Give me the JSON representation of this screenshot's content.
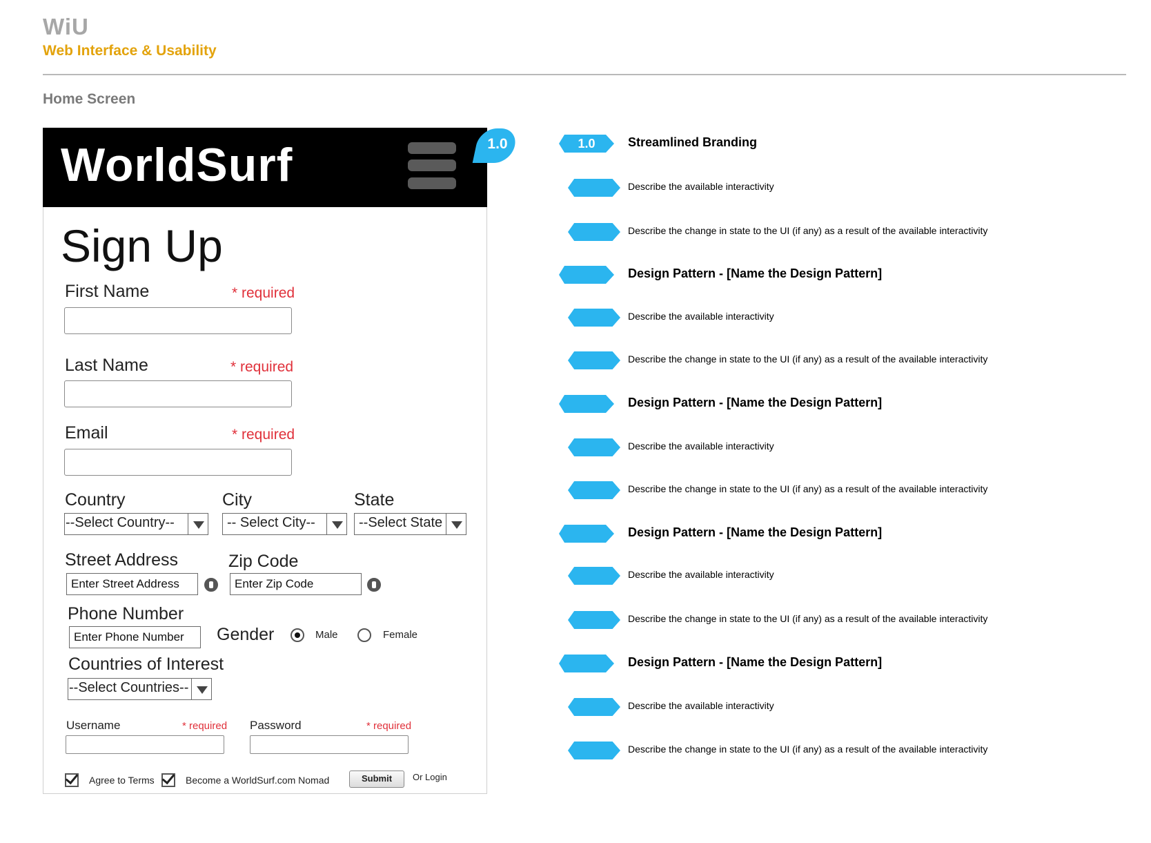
{
  "header": {
    "brand": "WiU",
    "subtitle": "Web Interface & Usability",
    "screen_title": "Home Screen"
  },
  "mockup": {
    "logo": "WorldSurf",
    "badge": "1.0",
    "page_title": "Sign Up",
    "first_name": {
      "label": "First Name",
      "required": "* required"
    },
    "last_name": {
      "label": "Last Name",
      "required": "* required"
    },
    "email": {
      "label": "Email",
      "required": "* required"
    },
    "country": {
      "label": "Country",
      "value": "--Select Country--"
    },
    "city": {
      "label": "City",
      "value": "-- Select City--"
    },
    "state": {
      "label": "State",
      "value": "--Select State"
    },
    "street": {
      "label": "Street Address",
      "placeholder": "Enter Street Address"
    },
    "zip": {
      "label": "Zip Code",
      "placeholder": "Enter Zip Code"
    },
    "phone": {
      "label": "Phone Number",
      "placeholder": "Enter Phone Number"
    },
    "gender": {
      "label": "Gender",
      "male": "Male",
      "female": "Female",
      "selected": "Male"
    },
    "countries_interest": {
      "label": "Countries of Interest",
      "value": "--Select Countries--"
    },
    "username": {
      "label": "Username",
      "required": "* required"
    },
    "password": {
      "label": "Password",
      "required": "* required"
    },
    "agree_terms": "Agree to Terms",
    "become_nomad": "Become a WorldSurf.com Nomad",
    "submit": "Submit",
    "or_login": "Or Login"
  },
  "annotations": [
    {
      "tag": "1.0",
      "text": "Streamlined Branding",
      "heading": true
    },
    {
      "tag": "",
      "text": "Describe the available interactivity",
      "heading": false
    },
    {
      "tag": "",
      "text": "Describe the change in state to the UI (if any) as a result of the available interactivity",
      "heading": false
    },
    {
      "tag": "",
      "text": "Design Pattern - [Name the Design Pattern]",
      "heading": true
    },
    {
      "tag": "",
      "text": "Describe the available interactivity",
      "heading": false
    },
    {
      "tag": "",
      "text": "Describe the change in state to the UI (if any) as a result of the available interactivity",
      "heading": false
    },
    {
      "tag": "",
      "text": "Design Pattern - [Name the Design Pattern]",
      "heading": true
    },
    {
      "tag": "",
      "text": "Describe the available interactivity",
      "heading": false
    },
    {
      "tag": "",
      "text": "Describe the change in state to the UI (if any) as a result of the available interactivity",
      "heading": false
    },
    {
      "tag": "",
      "text": "Design Pattern - [Name the Design Pattern]",
      "heading": true
    },
    {
      "tag": "",
      "text": "Describe the available interactivity",
      "heading": false
    },
    {
      "tag": "",
      "text": "Describe the change in state to the UI (if any) as a result of the available interactivity",
      "heading": false
    },
    {
      "tag": "",
      "text": "Design Pattern - [Name the Design Pattern]",
      "heading": true
    },
    {
      "tag": "",
      "text": "Describe the available interactivity",
      "heading": false
    },
    {
      "tag": "",
      "text": "Describe the change in state to the UI (if any) as a result of the available interactivity",
      "heading": false
    }
  ],
  "colors": {
    "accent_blue": "#2bb5ef",
    "brand_orange": "#e3a30c",
    "required_red": "#e0303a"
  }
}
